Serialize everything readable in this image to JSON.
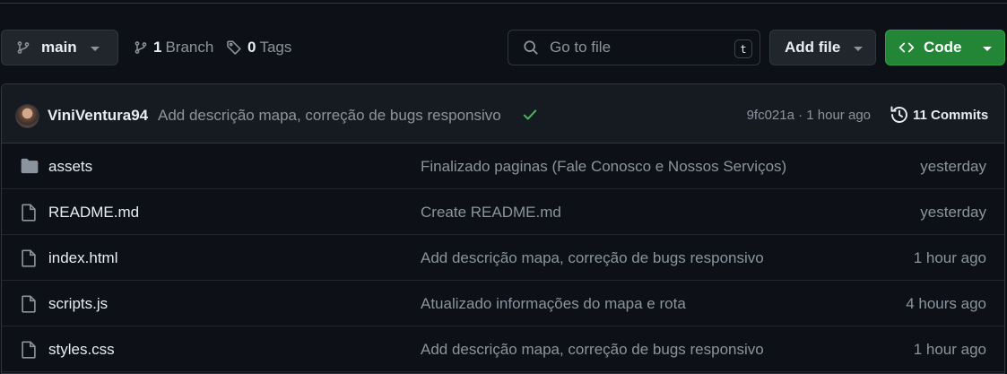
{
  "toolbar": {
    "branch_name": "main",
    "branch_count": "1",
    "branch_label": "Branch",
    "tag_count": "0",
    "tag_label": "Tags",
    "search_placeholder": "Go to file",
    "search_shortcut": "t",
    "add_file_label": "Add file",
    "code_label": "Code"
  },
  "latest_commit": {
    "author": "ViniVentura94",
    "message": "Add descrição mapa, correção de bugs responsivo",
    "status": "success",
    "sha_time": "9fc021a · 1 hour ago",
    "commits_label": "11 Commits"
  },
  "files": [
    {
      "name": "assets",
      "type": "folder",
      "message": "Finalizado paginas (Fale Conosco e Nossos Serviços)",
      "time": "yesterday"
    },
    {
      "name": "README.md",
      "type": "file",
      "message": "Create README.md",
      "time": "yesterday"
    },
    {
      "name": "index.html",
      "type": "file",
      "message": "Add descrição mapa, correção de bugs responsivo",
      "time": "1 hour ago"
    },
    {
      "name": "scripts.js",
      "type": "file",
      "message": "Atualizado informações do mapa e rota",
      "time": "4 hours ago"
    },
    {
      "name": "styles.css",
      "type": "file",
      "message": "Add descrição mapa, correção de bugs responsivo",
      "time": "1 hour ago"
    }
  ],
  "colors": {
    "background": "#0d1117",
    "border": "#30363d",
    "code_button": "#238636",
    "success_check": "#3fb950",
    "muted_text": "#8b949e"
  },
  "icons": {
    "branch": "git-branch-icon",
    "tag": "tag-icon",
    "search": "search-icon",
    "code": "code-icon",
    "history": "history-icon",
    "check": "check-icon",
    "folder": "folder-icon",
    "file": "file-icon"
  }
}
